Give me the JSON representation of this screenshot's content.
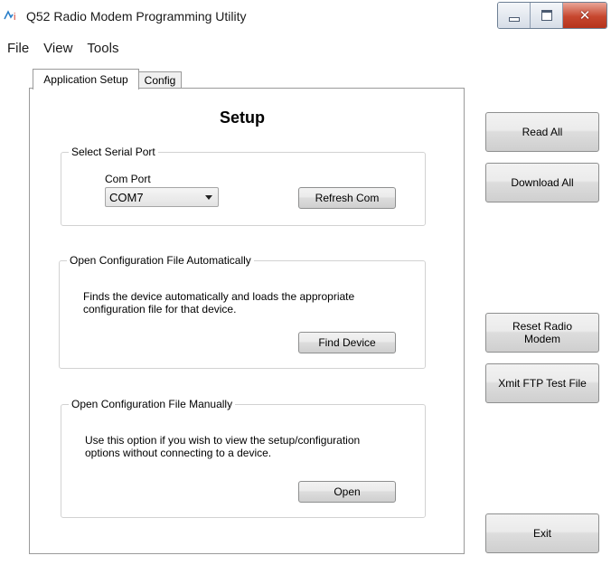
{
  "window": {
    "title": "Q52 Radio Modem Programming Utility",
    "icon": "ati-logo-icon",
    "controls": {
      "minimize": "_",
      "maximize": "□",
      "close": "✕"
    }
  },
  "menu": [
    "File",
    "View",
    "Tools"
  ],
  "tabs": [
    {
      "label": "Application Setup",
      "active": true
    },
    {
      "label": "Config",
      "active": false
    }
  ],
  "setup": {
    "title": "Setup",
    "serial_port": {
      "group_label": "Select Serial Port",
      "com_label": "Com Port",
      "com_value": "COM7",
      "refresh_label": "Refresh Com"
    },
    "auto_config": {
      "group_label": "Open Configuration File Automatically",
      "description": "Finds the device automatically and loads the appropriate\nconfiguration file for that device.",
      "button_label": "Find Device"
    },
    "manual_config": {
      "group_label": "Open Configuration File Manually",
      "description": "Use this option if you wish to view the setup/configuration\noptions without connecting to a device.",
      "button_label": "Open"
    }
  },
  "side_buttons": {
    "read_all": "Read All",
    "download_all": "Download All",
    "reset_radio": "Reset Radio\nModem",
    "xmit_ftp": "Xmit FTP Test File",
    "exit": "Exit"
  }
}
